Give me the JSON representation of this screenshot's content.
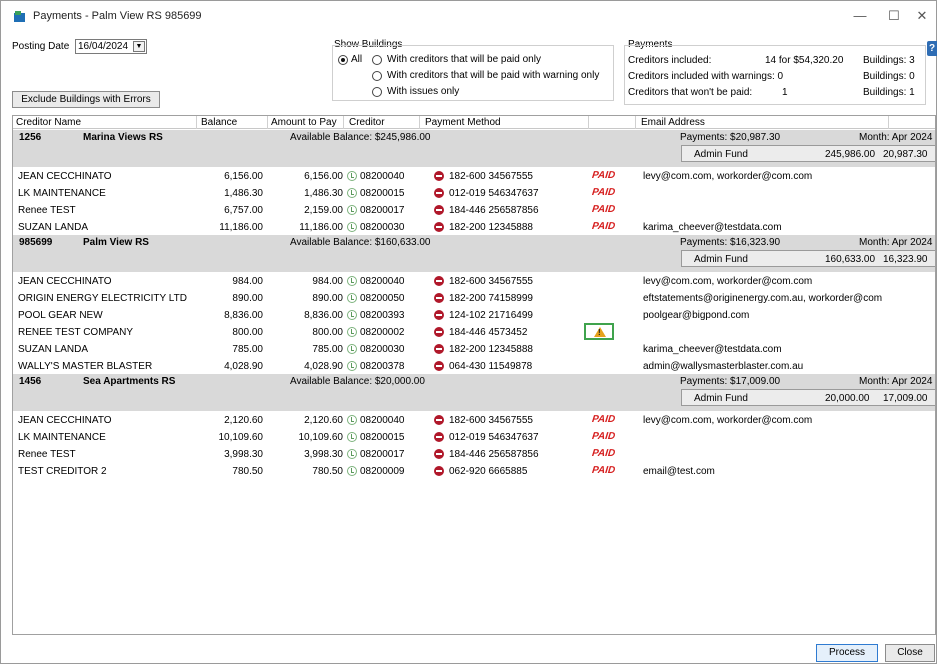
{
  "window": {
    "title": "Payments - Palm View RS 985699"
  },
  "filters": {
    "posting_date_label": "Posting Date",
    "posting_date_value": "16/04/2024",
    "exclude_button": "Exclude Buildings with Errors",
    "show_buildings_label": "Show Buildings",
    "opt_all": "All",
    "opt_paid_only": "With creditors that will be paid only",
    "opt_paid_warning": "With creditors that will be paid with warning only",
    "opt_issues": "With issues only"
  },
  "summary": {
    "title": "Payments",
    "included_label": "Creditors included:",
    "included_value": "14 for $54,320.20",
    "included_buildings": "Buildings: 3",
    "warnings_label": "Creditors included with warnings: 0",
    "warnings_buildings": "Buildings: 0",
    "not_paid_label": "Creditors that won't be paid:",
    "not_paid_value": "1",
    "not_paid_buildings": "Buildings: 1"
  },
  "columns": {
    "creditor_name": "Creditor Name",
    "balance": "Balance",
    "amount_to_pay": "Amount to Pay",
    "creditor": "Creditor",
    "payment_method": "Payment Method",
    "email_address": "Email Address"
  },
  "buildings": [
    {
      "code": "1256",
      "name": "Marina Views RS",
      "available": "Available Balance: $245,986.00",
      "payments": "Payments: $20,987.30",
      "month": "Month: Apr 2024",
      "fund_name": "Admin Fund",
      "fund_balance": "245,986.00",
      "fund_payment": "20,987.30",
      "rows": [
        {
          "name": "JEAN CECCHINATO",
          "balance": "6,156.00",
          "amount": "6,156.00",
          "creditor": "08200040",
          "method": "182-600  34567555",
          "status": "PAID",
          "email": "levy@com.com, workorder@com.com"
        },
        {
          "name": "LK MAINTENANCE",
          "balance": "1,486.30",
          "amount": "1,486.30",
          "creditor": "08200015",
          "method": "012-019  546347637",
          "status": "PAID",
          "email": ""
        },
        {
          "name": "Renee TEST",
          "balance": "6,757.00",
          "amount": "2,159.00",
          "creditor": "08200017",
          "method": "184-446  256587856",
          "status": "PAID",
          "email": ""
        },
        {
          "name": "SUZAN LANDA",
          "balance": "11,186.00",
          "amount": "11,186.00",
          "creditor": "08200030",
          "method": "182-200  12345888",
          "status": "PAID",
          "email": "karima_cheever@testdata.com"
        }
      ]
    },
    {
      "code": "985699",
      "name": "Palm View RS",
      "available": "Available Balance: $160,633.00",
      "payments": "Payments: $16,323.90",
      "month": "Month: Apr 2024",
      "fund_name": "Admin Fund",
      "fund_balance": "160,633.00",
      "fund_payment": "16,323.90",
      "rows": [
        {
          "name": "JEAN CECCHINATO",
          "balance": "984.00",
          "amount": "984.00",
          "creditor": "08200040",
          "method": "182-600  34567555",
          "status": "",
          "email": "levy@com.com, workorder@com.com"
        },
        {
          "name": "ORIGIN ENERGY ELECTRICITY LTD",
          "balance": "890.00",
          "amount": "890.00",
          "creditor": "08200050",
          "method": "182-200  74158999",
          "status": "",
          "email": "eftstatements@originenergy.com.au, workorder@com"
        },
        {
          "name": "POOL GEAR NEW",
          "balance": "8,836.00",
          "amount": "8,836.00",
          "creditor": "08200393",
          "method": "124-102  21716499",
          "status": "",
          "email": "poolgear@bigpond.com"
        },
        {
          "name": "RENEE TEST COMPANY",
          "balance": "800.00",
          "amount": "800.00",
          "creditor": "08200002",
          "method": "184-446  4573452",
          "status": "WARN",
          "email": ""
        },
        {
          "name": "SUZAN LANDA",
          "balance": "785.00",
          "amount": "785.00",
          "creditor": "08200030",
          "method": "182-200  12345888",
          "status": "",
          "email": "karima_cheever@testdata.com"
        },
        {
          "name": "WALLY'S MASTER BLASTER",
          "balance": "4,028.90",
          "amount": "4,028.90",
          "creditor": "08200378",
          "method": "064-430  11549878",
          "status": "",
          "email": "admin@wallysmasterblaster.com.au"
        }
      ]
    },
    {
      "code": "1456",
      "name": "Sea Apartments RS",
      "available": "Available Balance: $20,000.00",
      "payments": "Payments: $17,009.00",
      "month": "Month: Apr 2024",
      "fund_name": "Admin Fund",
      "fund_balance": "20,000.00",
      "fund_payment": "17,009.00",
      "rows": [
        {
          "name": "JEAN CECCHINATO",
          "balance": "2,120.60",
          "amount": "2,120.60",
          "creditor": "08200040",
          "method": "182-600  34567555",
          "status": "PAID",
          "email": "levy@com.com, workorder@com.com"
        },
        {
          "name": "LK MAINTENANCE",
          "balance": "10,109.60",
          "amount": "10,109.60",
          "creditor": "08200015",
          "method": "012-019  546347637",
          "status": "PAID",
          "email": ""
        },
        {
          "name": "Renee TEST",
          "balance": "3,998.30",
          "amount": "3,998.30",
          "creditor": "08200017",
          "method": "184-446  256587856",
          "status": "PAID",
          "email": ""
        },
        {
          "name": "TEST CREDITOR 2",
          "balance": "780.50",
          "amount": "780.50",
          "creditor": "08200009",
          "method": "062-920  6665885",
          "status": "PAID",
          "email": "email@test.com"
        }
      ]
    }
  ],
  "footer": {
    "process": "Process",
    "close": "Close"
  },
  "icons": {
    "app": "payments-app-icon",
    "creditor": "clock-icon",
    "payment": "bank-icon",
    "warning": "warning-icon",
    "help": "help-icon"
  }
}
